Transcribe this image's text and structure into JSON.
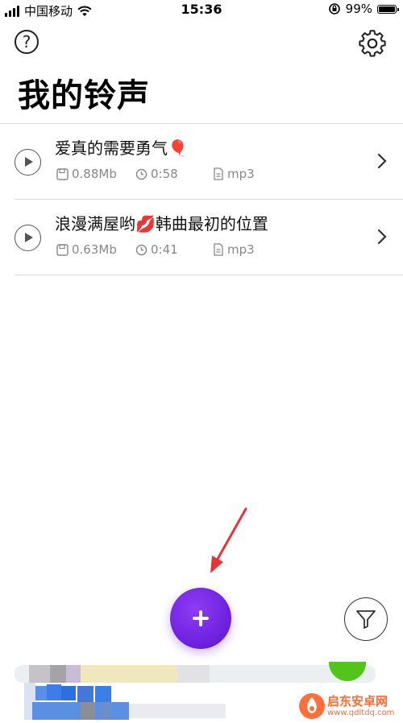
{
  "status_bar": {
    "carrier": "中国移动",
    "time": "15:36",
    "battery_percent": "99%",
    "battery_level": 0.99
  },
  "header": {
    "help_label": "?",
    "title": "我的铃声"
  },
  "ringtones": [
    {
      "title": "爱真的需要勇气🎈",
      "size": "0.88Mb",
      "duration": "0:58",
      "format": "mp3"
    },
    {
      "title": "浪漫满屋哟💋韩曲最初的位置",
      "size": "0.63Mb",
      "duration": "0:41",
      "format": "mp3"
    }
  ],
  "watermark": {
    "name": "启东安卓网",
    "url": "www.qdltdq.com"
  },
  "colors": {
    "accent": "#7b2ff0",
    "annotation_arrow": "#e8333a",
    "divider": "#dcdcdc",
    "meta_text": "#888888"
  }
}
